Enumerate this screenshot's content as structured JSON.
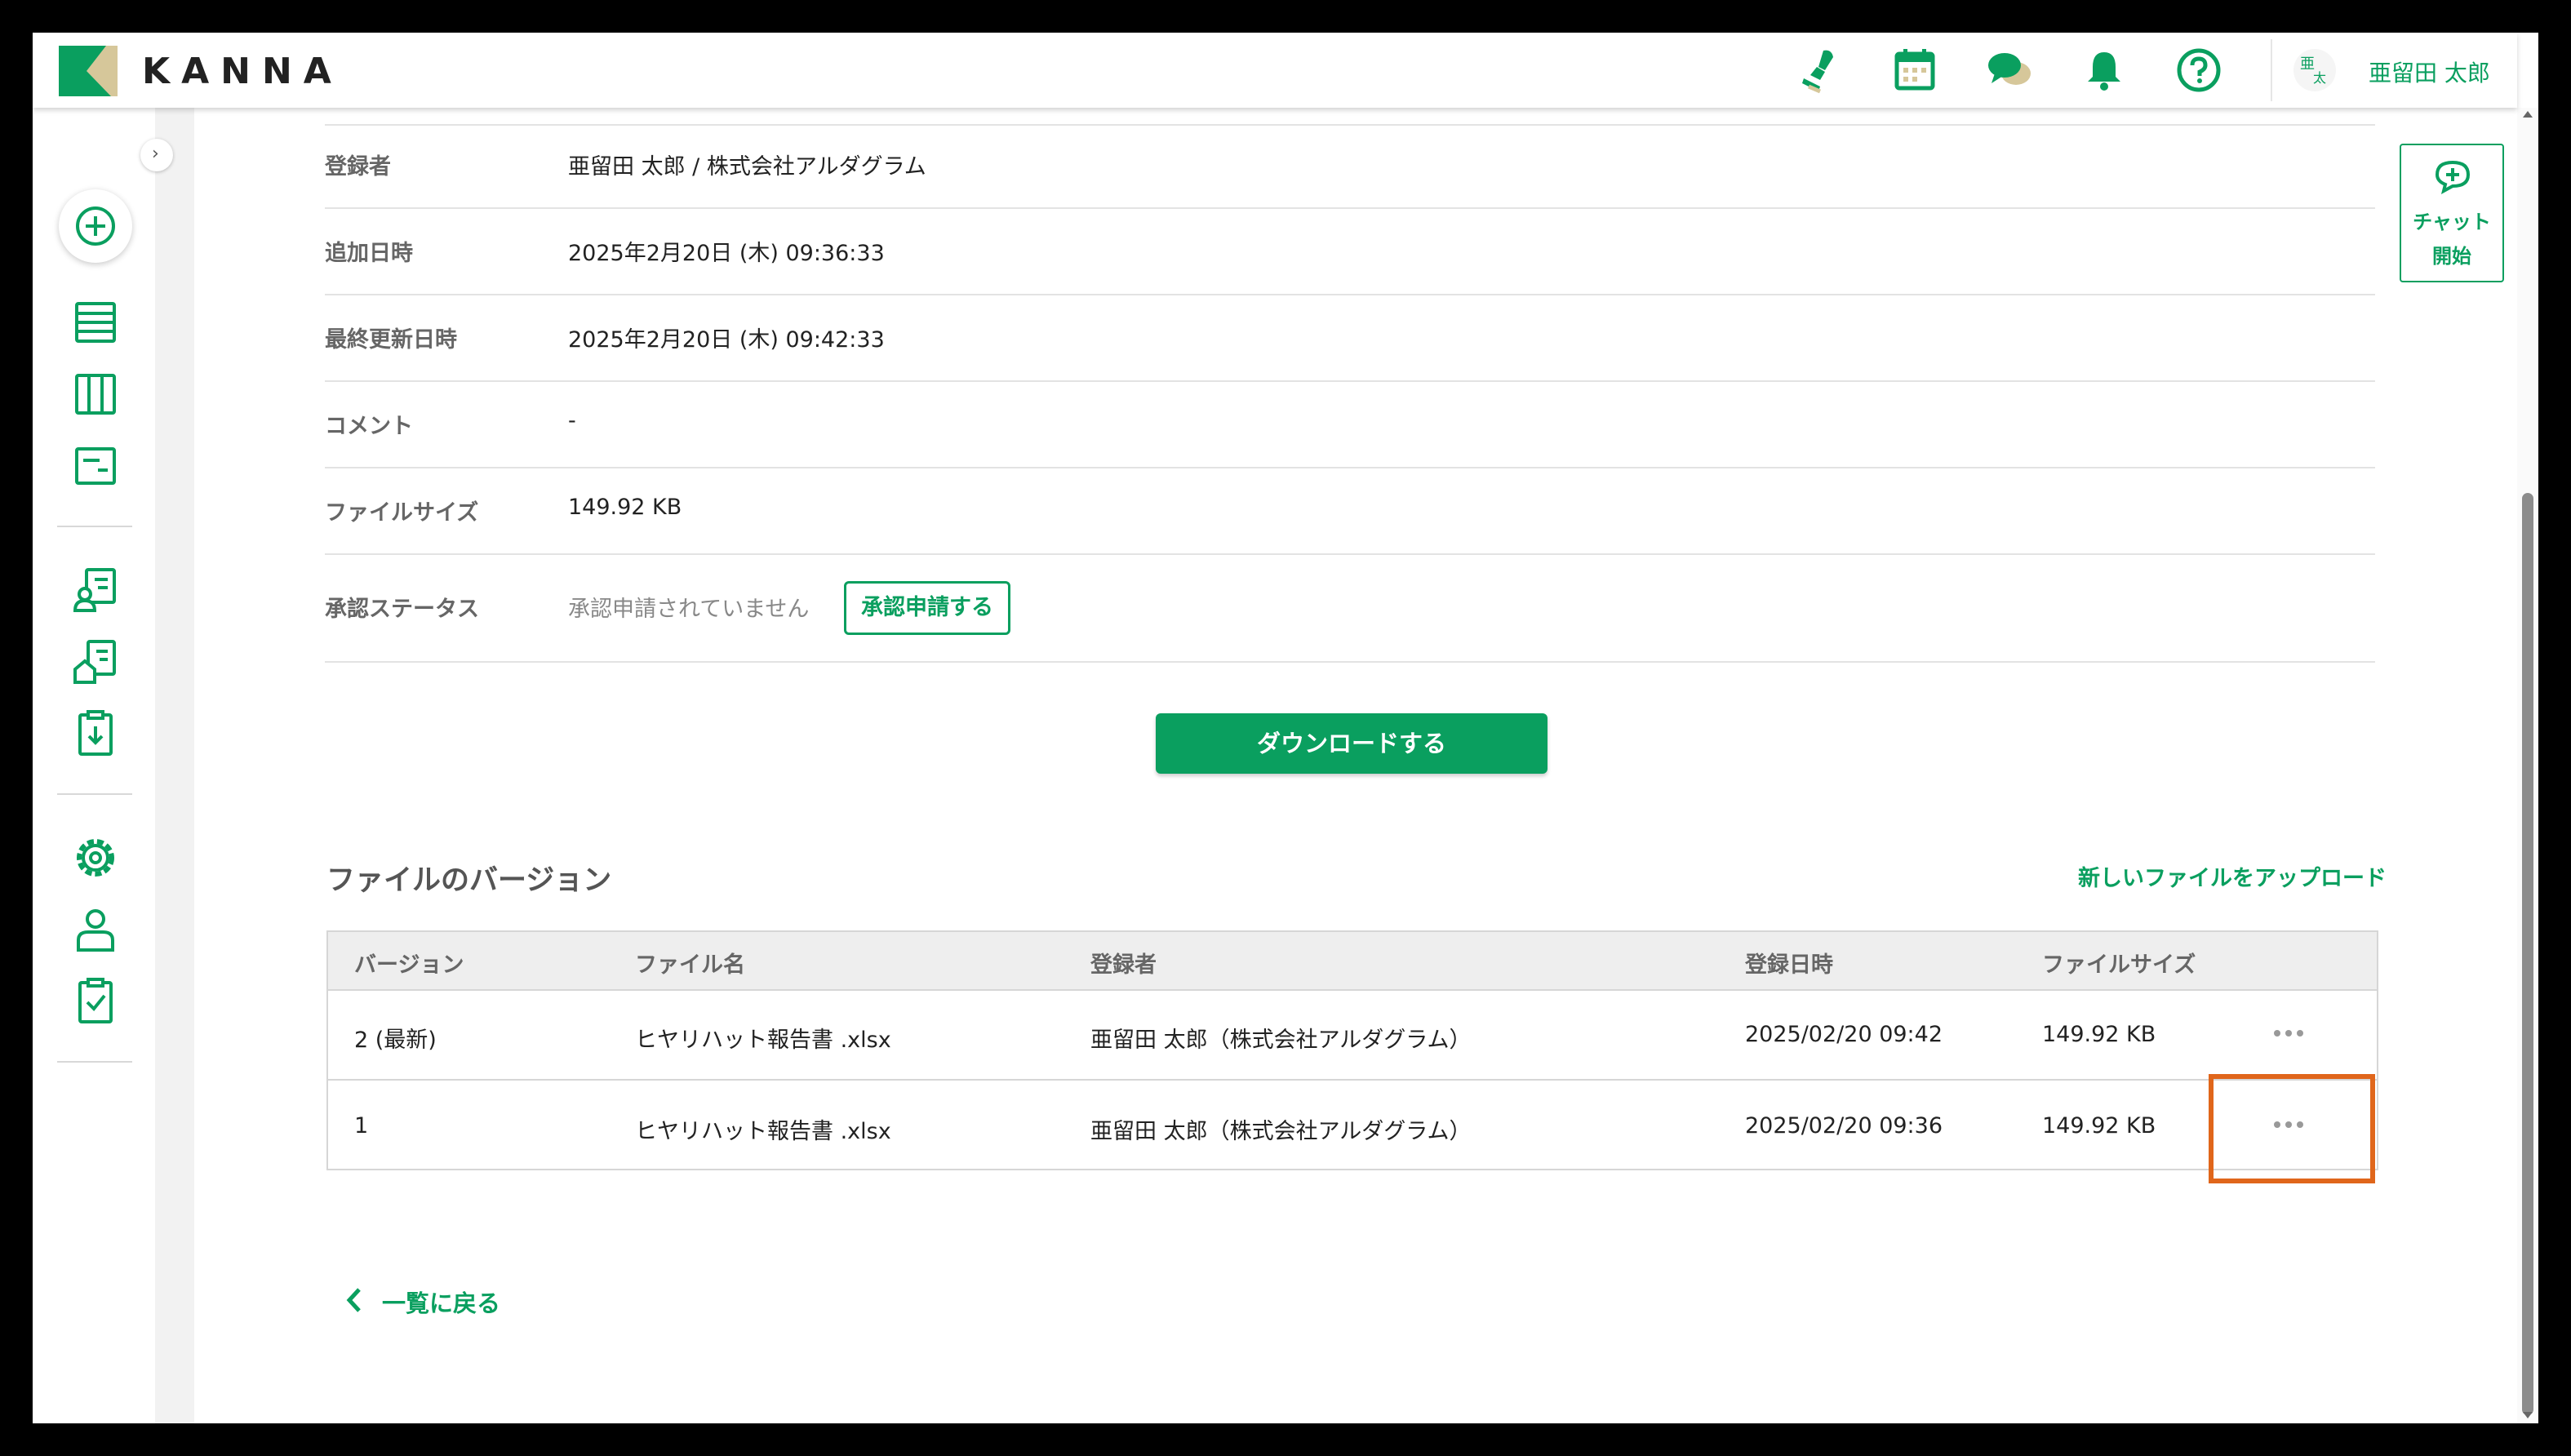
{
  "header": {
    "logo_text": "KANNA",
    "user_name": "亜留田 太郎",
    "user_avatar_initials": [
      "亜",
      "太"
    ],
    "icons": [
      "stamp-icon",
      "calendar-icon",
      "chat-icon",
      "bell-icon",
      "help-icon"
    ]
  },
  "sidebar": {
    "items": [
      "add-icon",
      "list-icon",
      "board-icon",
      "card-icon",
      "contacts-icon",
      "property-icon",
      "download-clipboard-icon",
      "settings-icon",
      "user-icon",
      "checklist-icon"
    ]
  },
  "details": {
    "rows": [
      {
        "label": "登録者",
        "value": "亜留田 太郎 / 株式会社アルダグラム"
      },
      {
        "label": "追加日時",
        "value": "2025年2月20日 (木) 09:36:33"
      },
      {
        "label": "最終更新日時",
        "value": "2025年2月20日 (木) 09:42:33"
      },
      {
        "label": "コメント",
        "value": "-"
      },
      {
        "label": "ファイルサイズ",
        "value": "149.92 KB"
      },
      {
        "label": "承認ステータス",
        "value": "承認申請されていません"
      }
    ],
    "apply_button": "承認申請する",
    "download_button": "ダウンロードする"
  },
  "versions": {
    "title": "ファイルのバージョン",
    "upload_link": "新しいファイルをアップロード",
    "columns": [
      "バージョン",
      "ファイル名",
      "登録者",
      "登録日時",
      "ファイルサイズ"
    ],
    "rows": [
      {
        "version": "2 (最新)",
        "file": "ヒヤリハット報告書 .xlsx",
        "registrant": "亜留田 太郎（株式会社アルダグラム）",
        "date": "2025/02/20 09:42",
        "size": "149.92 KB"
      },
      {
        "version": "1",
        "file": "ヒヤリハット報告書 .xlsx",
        "registrant": "亜留田 太郎（株式会社アルダグラム）",
        "date": "2025/02/20 09:36",
        "size": "149.92 KB"
      }
    ]
  },
  "back_link": "一覧に戻る",
  "chat_panel": {
    "line1": "チャット",
    "line2": "開始"
  },
  "colors": {
    "accent": "#0a9f5f",
    "highlight": "#e0661b"
  }
}
